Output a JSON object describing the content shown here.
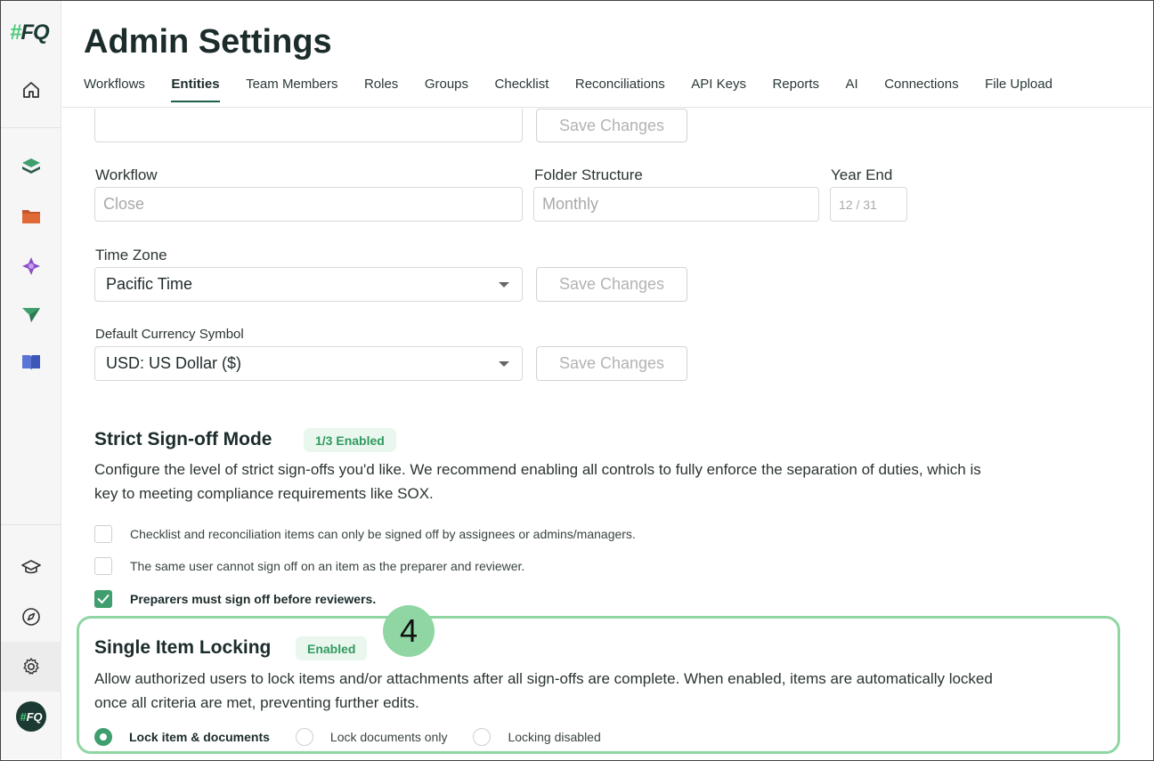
{
  "app": {
    "logo_hash": "#",
    "logo_text": "FQ",
    "avatar_hash": "#",
    "avatar_text": "FQ"
  },
  "header": {
    "title": "Admin Settings",
    "tabs": [
      {
        "label": "Workflows"
      },
      {
        "label": "Entities",
        "active": true
      },
      {
        "label": "Team Members"
      },
      {
        "label": "Roles"
      },
      {
        "label": "Groups"
      },
      {
        "label": "Checklist"
      },
      {
        "label": "Reconciliations"
      },
      {
        "label": "API Keys"
      },
      {
        "label": "Reports"
      },
      {
        "label": "AI"
      },
      {
        "label": "Connections"
      },
      {
        "label": "File Upload"
      }
    ]
  },
  "sidebar": {
    "icons": [
      "home-icon",
      "stack-icon",
      "folder-icon",
      "sparkle-icon",
      "paper-plane-icon",
      "book-icon",
      "graduation-cap-icon",
      "compass-icon",
      "gear-icon"
    ]
  },
  "form": {
    "top_save_label": "Save Changes",
    "workflow": {
      "label": "Workflow",
      "placeholder": "Close"
    },
    "folder_structure": {
      "label": "Folder Structure",
      "placeholder": "Monthly"
    },
    "year_end": {
      "label": "Year End",
      "placeholder": "12 / 31"
    },
    "time_zone": {
      "label": "Time Zone",
      "value": "Pacific Time",
      "save_label": "Save Changes"
    },
    "currency": {
      "label": "Default Currency Symbol",
      "value": "USD: US Dollar ($)",
      "save_label": "Save Changes"
    }
  },
  "strict_signoff": {
    "title": "Strict Sign-off Mode",
    "badge": "1/3 Enabled",
    "description_line1": "Configure the level of strict sign-offs you'd like. We recommend enabling all controls to fully enforce the separation of duties, which is",
    "description_line2": "key to meeting compliance requirements like SOX.",
    "options": [
      {
        "label": "Checklist and reconciliation items can only be signed off by assignees or admins/managers.",
        "checked": false
      },
      {
        "label": "The same user cannot sign off on an item as the preparer and reviewer.",
        "checked": false
      },
      {
        "label": "Preparers must sign off before reviewers.",
        "checked": true
      }
    ]
  },
  "single_item_locking": {
    "step_number": "4",
    "title": "Single Item Locking",
    "badge": "Enabled",
    "description_line1": "Allow authorized users to lock items and/or attachments after all sign-offs are complete. When enabled, items are automatically locked",
    "description_line2": "once all criteria are met, preventing further edits.",
    "options": [
      {
        "label": "Lock item & documents",
        "selected": true
      },
      {
        "label": "Lock documents only",
        "selected": false
      },
      {
        "label": "Locking disabled",
        "selected": false
      }
    ]
  },
  "colors": {
    "accent": "#3f9e6e",
    "highlight": "#8fd6a3",
    "brand_dark": "#1b3a33"
  }
}
